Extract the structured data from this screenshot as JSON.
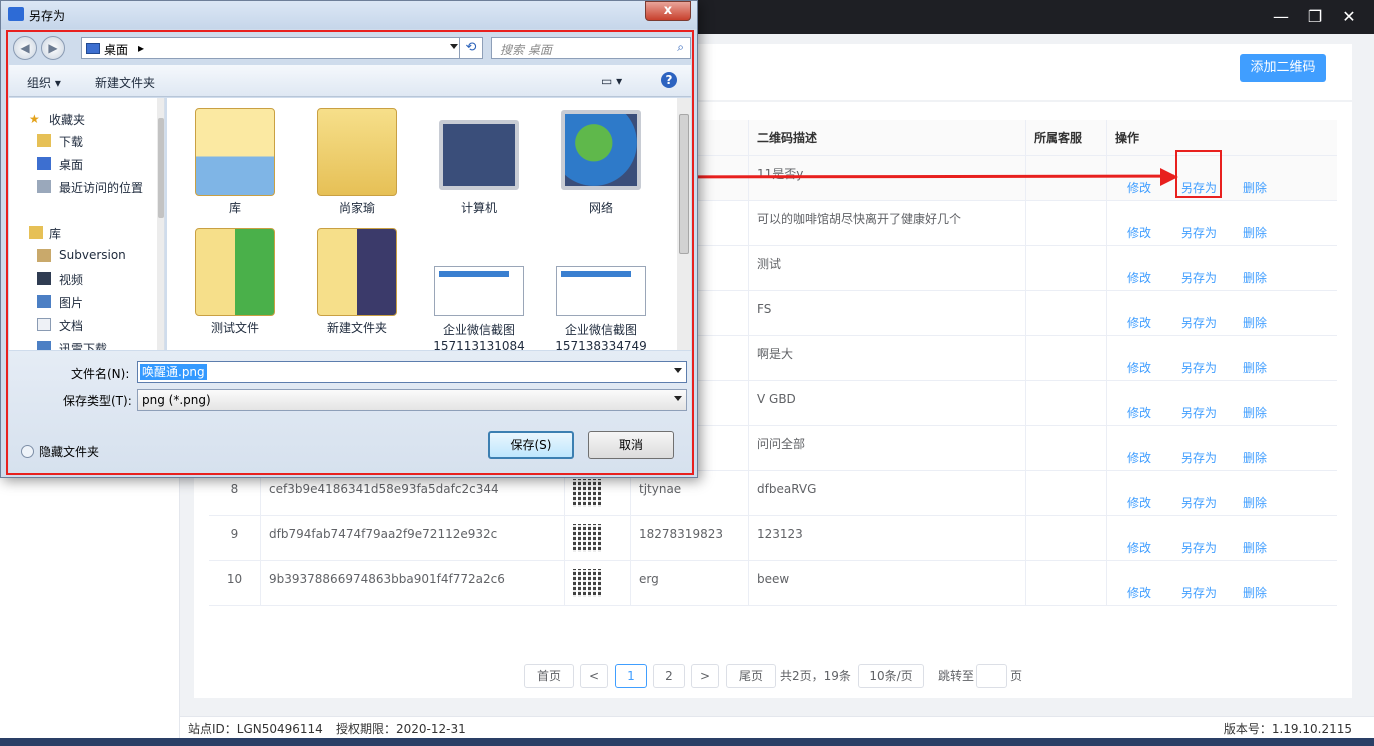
{
  "app": {
    "add_qr_button": "添加二维码",
    "table": {
      "headers": [
        "",
        "",
        "",
        "",
        "二维码描述",
        "所属客服",
        "操作"
      ],
      "rows": [
        {
          "index": "",
          "id": "",
          "user": "",
          "desc": "11是否y"
        },
        {
          "index": "",
          "id": "",
          "user": "",
          "desc": "可以的咖啡馆胡尽快离开了健康好几个"
        },
        {
          "index": "",
          "id": "",
          "user": "",
          "desc": "测试"
        },
        {
          "index": "",
          "id": "",
          "user": "",
          "desc": "FS"
        },
        {
          "index": "",
          "id": "",
          "user": "",
          "desc": "啊是大"
        },
        {
          "index": "",
          "id": "",
          "user": "",
          "desc": "V GBD"
        },
        {
          "index": "",
          "id": "",
          "user": "",
          "desc": "问问全部"
        },
        {
          "index": "8",
          "id": "cef3b9e4186341d58e93fa5dafc2c344",
          "user": "tjtynae",
          "desc": "dfbeaRVG"
        },
        {
          "index": "9",
          "id": "dfb794fab7474f79aa2f9e72112e932c",
          "user": "18278319823",
          "desc": "123123"
        },
        {
          "index": "10",
          "id": "9b39378866974863bba901f4f772a2c6",
          "user": "erg",
          "desc": "beew"
        }
      ],
      "ops": {
        "edit": "修改",
        "save_as": "另存为",
        "delete": "删除"
      }
    },
    "pagination": {
      "first": "首页",
      "prev": "<",
      "pages": [
        "1",
        "2"
      ],
      "current": "1",
      "next": ">",
      "last": "尾页",
      "summary": "共2页，19条",
      "page_size": "10条/页",
      "jump_label": "跳转至",
      "jump_value": "",
      "page_unit": "页"
    },
    "footer": {
      "site": "站点ID：LGN50496114",
      "license": "授权期限：2020-12-31",
      "version": "版本号：1.19.10.2115"
    }
  },
  "dialog": {
    "title": "另存为",
    "close": "x",
    "address": "桌面",
    "address_sep": "▸",
    "search_placeholder": "搜索 桌面",
    "toolbar": {
      "organize": "组织 ▾",
      "new_folder": "新建文件夹",
      "help": "?"
    },
    "nav": {
      "favorites": "收藏夹",
      "download": "下载",
      "desktop": "桌面",
      "recent": "最近访问的位置",
      "library": "库",
      "subversion": "Subversion",
      "video": "视频",
      "pictures": "图片",
      "docs": "文档",
      "thunder": "迅雷下载"
    },
    "files": [
      {
        "label": "库"
      },
      {
        "label": "尚家瑜"
      },
      {
        "label": "计算机"
      },
      {
        "label": "网络"
      },
      {
        "label": "测试文件"
      },
      {
        "label": "新建文件夹"
      },
      {
        "label": "企业微信截图\n157113131084"
      },
      {
        "label": "企业微信截图\n157138334749"
      }
    ],
    "filename_label": "文件名(N):",
    "filename_value": "唤醒通.png",
    "filetype_label": "保存类型(T):",
    "filetype_value": "png (*.png)",
    "hide_folders": "隐藏文件夹",
    "save_button": "保存(S)",
    "cancel_button": "取消"
  },
  "colors": {
    "accent": "#409eff",
    "annotation": "#e8201e"
  }
}
